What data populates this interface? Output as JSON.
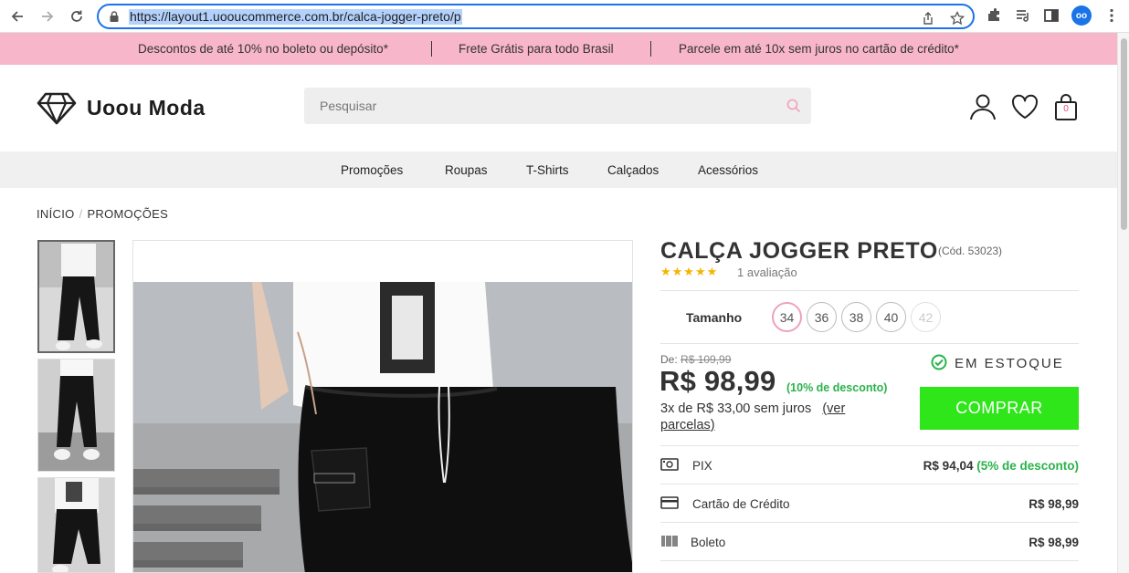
{
  "browser": {
    "url": "https://layout1.uooucommerce.com.br/calca-jogger-preto/p",
    "back_icon": "arrow-left-icon",
    "forward_icon": "arrow-right-icon",
    "reload_icon": "reload-icon",
    "profile_initials": "oo"
  },
  "promo": {
    "items": [
      "Descontos de até 10% no boleto ou depósito*",
      "Frete Grátis para todo Brasil",
      "Parcele em até 10x sem juros no cartão de crédito*"
    ],
    "color": "#f8b6cb"
  },
  "header": {
    "logo_text": "Uoou Moda",
    "search_placeholder": "Pesquisar",
    "cart_count": "0"
  },
  "nav": {
    "items": [
      "Promoções",
      "Roupas",
      "T-Shirts",
      "Calçados",
      "Acessórios"
    ]
  },
  "breadcrumb": {
    "items": [
      "INÍCIO",
      "PROMOÇÕES"
    ]
  },
  "product": {
    "title": "CALÇA JOGGER PRETO",
    "code": "(Cód. 53023)",
    "stars": "★★★★★",
    "reviews": "1 avaliação",
    "size_label": "Tamanho",
    "sizes": [
      {
        "label": "34",
        "state": "selected"
      },
      {
        "label": "36",
        "state": "available"
      },
      {
        "label": "38",
        "state": "available"
      },
      {
        "label": "40",
        "state": "available"
      },
      {
        "label": "42",
        "state": "unavailable"
      }
    ],
    "from_label": "De:",
    "old_price": "R$ 109,99",
    "price": "R$ 98,99",
    "discount": "(10% de desconto)",
    "installments_text": "3x de R$ 33,00 sem juros",
    "installments_link": "(ver parcelas)",
    "stock": "EM ESTOQUE",
    "buy_label": "COMPRAR",
    "buy_color": "#2ee61a",
    "payments": [
      {
        "icon": "pix-icon",
        "label": "PIX",
        "value": "R$ 94,04",
        "extra": "(5% de desconto)"
      },
      {
        "icon": "credit-card-icon",
        "label": "Cartão de Crédito",
        "value": "R$ 98,99",
        "extra": ""
      },
      {
        "icon": "barcode-icon",
        "label": "Boleto",
        "value": "R$ 98,99",
        "extra": ""
      }
    ]
  }
}
